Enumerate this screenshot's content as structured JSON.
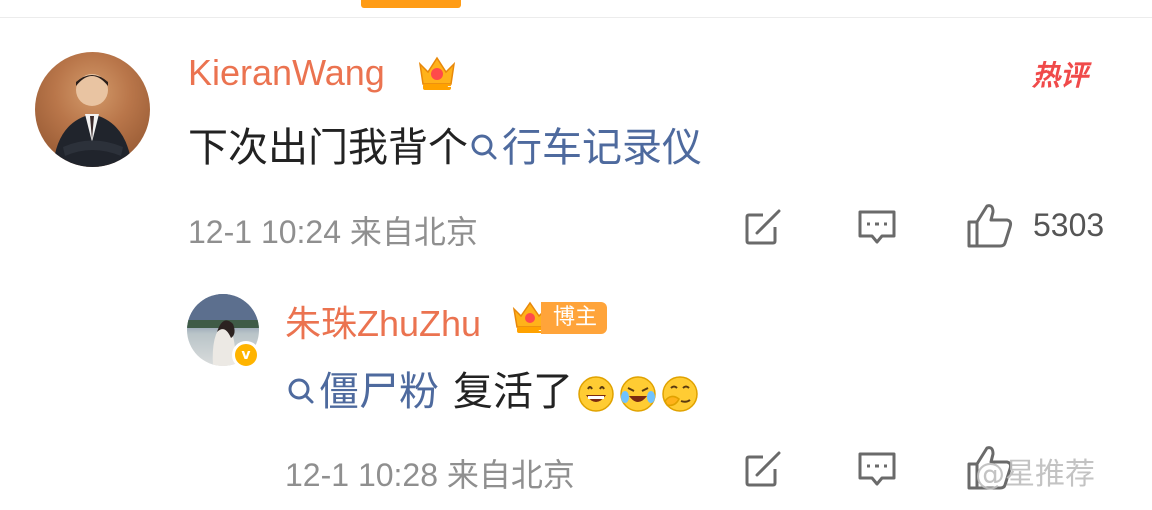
{
  "comments": [
    {
      "username": "KieranWang",
      "content_prefix": "下次出门我背个",
      "topic": "行车记录仪",
      "timestamp": "12-1 10:24",
      "location": "来自北京",
      "likes": "5303",
      "hot_label": "热评",
      "crown_level": "7"
    }
  ],
  "reply": {
    "username": "朱珠ZhuZhu",
    "badge_label": "博主",
    "verified_mark": "v",
    "crown_level": "7",
    "topic": "僵尸粉",
    "content_suffix": "复活了",
    "emojis": [
      "laughing-emoji",
      "crying-laughing-emoji",
      "smirk-emoji"
    ],
    "timestamp": "12-1 10:28",
    "location": "来自北京",
    "watermark": "@星推荐"
  },
  "colors": {
    "username": "#eb7350",
    "topic": "#4e6a9e",
    "meta": "#8f8f8f",
    "accent": "#ff9c16",
    "hot": "#f04a4a"
  }
}
